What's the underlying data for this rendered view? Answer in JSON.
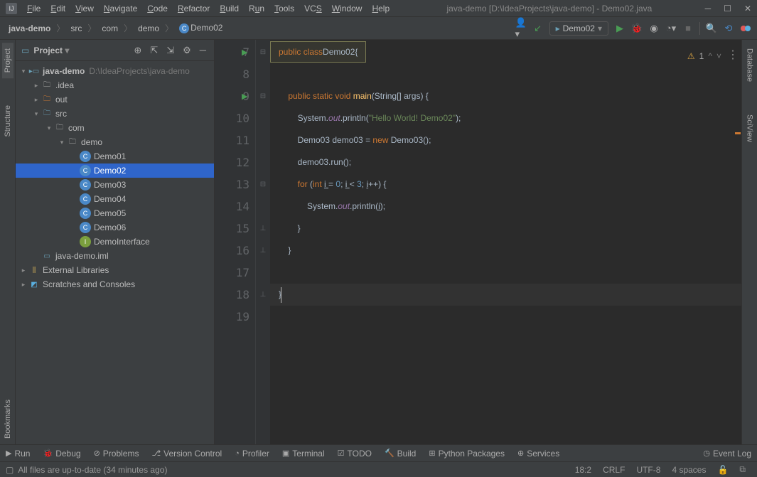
{
  "title": "java-demo [D:\\IdeaProjects\\java-demo] - Demo02.java",
  "menu": [
    "File",
    "Edit",
    "View",
    "Navigate",
    "Code",
    "Refactor",
    "Build",
    "Run",
    "Tools",
    "VCS",
    "Window",
    "Help"
  ],
  "breadcrumb": [
    "java-demo",
    "src",
    "com",
    "demo",
    "Demo02"
  ],
  "runConfig": "Demo02",
  "sidebar": {
    "title": "Project",
    "tree": {
      "project": "java-demo",
      "projectPath": "D:\\IdeaProjects\\java-demo",
      "idea": ".idea",
      "out": "out",
      "src": "src",
      "com": "com",
      "demo": "demo",
      "classes": [
        "Demo01",
        "Demo02",
        "Demo03",
        "Demo04",
        "Demo05",
        "Demo06"
      ],
      "iface": "DemoInterface",
      "iml": "java-demo.iml",
      "ext": "External Libraries",
      "scratch": "Scratches and Consoles"
    }
  },
  "leftTabs": [
    "Project",
    "Structure",
    "Bookmarks"
  ],
  "rightTabs": [
    "Database",
    "SciView"
  ],
  "gutter": {
    "start": 7,
    "end": 19,
    "runLines": [
      7,
      9
    ]
  },
  "code": {
    "l7": {
      "a": "public class ",
      "b": "Demo02 ",
      "c": "{"
    },
    "l9": {
      "a": "    public static ",
      "b": "void ",
      "c": "main",
      "d": "(String[] args) {"
    },
    "l10": {
      "a": "        System.",
      "b": "out",
      "c": ".println(",
      "d": "\"Hello World! Demo02\"",
      "e": ");"
    },
    "l11": {
      "a": "        Demo03 demo03 = ",
      "b": "new ",
      "c": "Demo03();"
    },
    "l12": {
      "a": "        demo03.run();"
    },
    "l13": {
      "a": "        ",
      "b": "for ",
      "c": "(",
      "d": "int ",
      "e": "i ",
      "f": "= ",
      "g": "0",
      "h": "; ",
      "i": "i ",
      "j": "< ",
      "k": "3",
      "l": "; ",
      "m": "i",
      "n": "++) {"
    },
    "l14": {
      "a": "            System.",
      "b": "out",
      "c": ".println(",
      "d": "i",
      "e": ");"
    },
    "l15": {
      "a": "        }"
    },
    "l16": {
      "a": "    }"
    },
    "l18": {
      "a": "}"
    }
  },
  "warning": "1",
  "bottomTabs": [
    "Run",
    "Debug",
    "Problems",
    "Version Control",
    "Profiler",
    "Terminal",
    "TODO",
    "Build",
    "Python Packages",
    "Services"
  ],
  "eventLog": "Event Log",
  "status": {
    "msg": "All files are up-to-date (34 minutes ago)",
    "pos": "18:2",
    "eol": "CRLF",
    "enc": "UTF-8",
    "indent": "4 spaces"
  }
}
